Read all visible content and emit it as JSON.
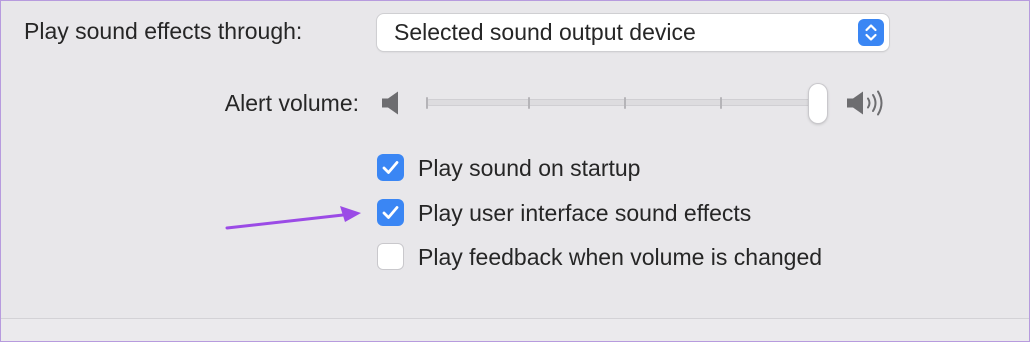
{
  "sound_effects": {
    "output_label": "Play sound effects through:",
    "output_value": "Selected sound output device",
    "alert_volume_label": "Alert volume:",
    "alert_volume_level": 1.0
  },
  "options": [
    {
      "label": "Play sound on startup",
      "checked": true
    },
    {
      "label": "Play user interface sound effects",
      "checked": true
    },
    {
      "label": "Play feedback when volume is changed",
      "checked": false
    }
  ],
  "colors": {
    "accent": "#3a86f4",
    "annotation_arrow": "#9b4be6"
  },
  "icons": {
    "stepper": "chevron-up-down-icon",
    "volume_low": "speaker-low-icon",
    "volume_high": "speaker-high-icon",
    "check": "checkmark-icon"
  }
}
